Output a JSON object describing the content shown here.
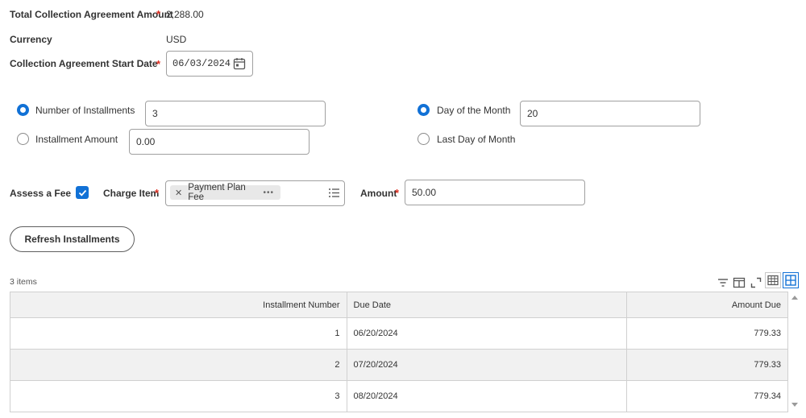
{
  "agreement": {
    "total_label": "Total Collection Agreement Amount",
    "total_value": "2,288.00",
    "currency_label": "Currency",
    "currency_value": "USD",
    "start_date_label": "Collection Agreement Start Date",
    "start_date_value": "06/03/2024"
  },
  "installments": {
    "number_label": "Number of Installments",
    "number_value": "3",
    "number_selected": true,
    "amount_label": "Installment Amount",
    "amount_value": "0.00",
    "amount_selected": false,
    "day_label": "Day of the Month",
    "day_value": "20",
    "day_selected": true,
    "last_day_label": "Last Day of Month",
    "last_day_selected": false
  },
  "fee": {
    "assess_label": "Assess a Fee",
    "assess_checked": true,
    "charge_item_label": "Charge Item",
    "charge_item_value": "Payment Plan Fee",
    "amount_label": "Amount",
    "amount_value": "50.00"
  },
  "actions": {
    "refresh_label": "Refresh Installments"
  },
  "table": {
    "item_count": "3 items",
    "columns": [
      "Installment Number",
      "Due Date",
      "Amount Due"
    ],
    "rows": [
      [
        "1",
        "06/20/2024",
        "779.33"
      ],
      [
        "2",
        "07/20/2024",
        "779.33"
      ],
      [
        "3",
        "08/20/2024",
        "779.34"
      ]
    ]
  },
  "colors": {
    "accent": "#1171d6",
    "required": "#de2e21",
    "row_alt": "#f1f1f1"
  },
  "icons": [
    "calendar-icon",
    "close-icon",
    "more-icon",
    "list-icon",
    "filter-icon",
    "columns-icon",
    "expand-icon",
    "table-view-icon",
    "grid-view-icon",
    "check-icon"
  ]
}
